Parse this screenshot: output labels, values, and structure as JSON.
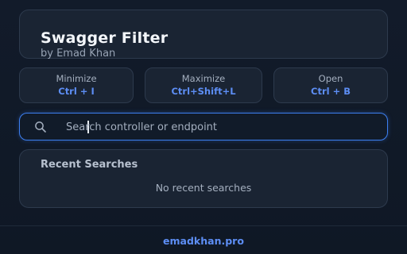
{
  "header": {
    "title": "Swagger Filter",
    "subtitle": "by Emad Khan"
  },
  "shortcuts": [
    {
      "label": "Minimize",
      "keys": "Ctrl + I"
    },
    {
      "label": "Maximize",
      "keys": "Ctrl+Shift+L"
    },
    {
      "label": "Open",
      "keys": "Ctrl + B"
    }
  ],
  "search": {
    "placeholder": "Search controller or endpoint",
    "value": "",
    "icon": "search-icon"
  },
  "recent": {
    "title": "Recent Searches",
    "empty_text": "No recent searches"
  },
  "footer": {
    "link_text": "emadkhan.pro"
  },
  "colors": {
    "accent": "#5d8ef5",
    "focus_border": "#3c7ff0",
    "background": "#111a28",
    "card": "#1a2433"
  }
}
